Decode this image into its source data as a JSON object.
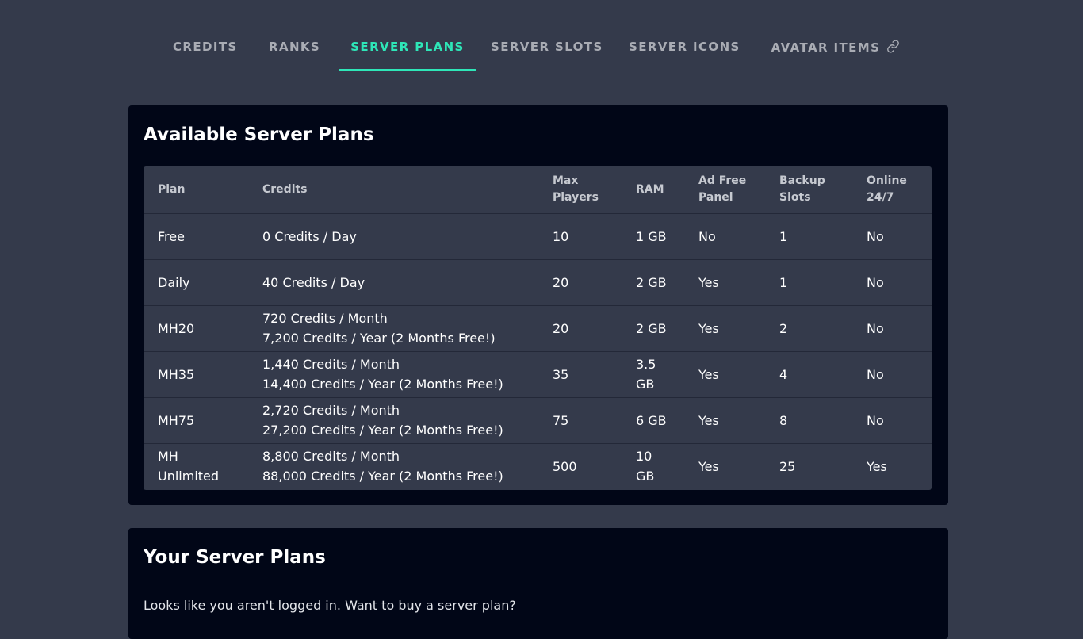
{
  "tabs": [
    {
      "label": "CREDITS",
      "active": false
    },
    {
      "label": "RANKS",
      "active": false
    },
    {
      "label": "SERVER PLANS",
      "active": true
    },
    {
      "label": "SERVER SLOTS",
      "active": false
    },
    {
      "label": "SERVER ICONS",
      "active": false
    },
    {
      "label": "AVATAR ITEMS",
      "active": false,
      "icon": "external-link-icon"
    }
  ],
  "colors": {
    "background": "#343a4b",
    "card": "#010617",
    "accent": "#2ee6b8",
    "tab_text": "#a9acb4"
  },
  "available_plans": {
    "title": "Available Server Plans",
    "headers": [
      [
        "Plan"
      ],
      [
        "Credits"
      ],
      [
        "Max",
        "Players"
      ],
      [
        "RAM"
      ],
      [
        "Ad Free",
        "Panel"
      ],
      [
        "Backup",
        "Slots"
      ],
      [
        "Online",
        "24/7"
      ]
    ],
    "rows": [
      {
        "plan": [
          "Free"
        ],
        "credits": [
          "0 Credits / Day"
        ],
        "max_players": [
          "10"
        ],
        "ram": [
          "1 GB"
        ],
        "ad_free": [
          "No"
        ],
        "backup_slots": [
          "1"
        ],
        "online": [
          "No"
        ]
      },
      {
        "plan": [
          "Daily"
        ],
        "credits": [
          "40 Credits / Day"
        ],
        "max_players": [
          "20"
        ],
        "ram": [
          "2 GB"
        ],
        "ad_free": [
          "Yes"
        ],
        "backup_slots": [
          "1"
        ],
        "online": [
          "No"
        ]
      },
      {
        "plan": [
          "MH20"
        ],
        "credits": [
          "720 Credits / Month",
          "7,200 Credits / Year (2 Months Free!)"
        ],
        "max_players": [
          "20"
        ],
        "ram": [
          "2 GB"
        ],
        "ad_free": [
          "Yes"
        ],
        "backup_slots": [
          "2"
        ],
        "online": [
          "No"
        ]
      },
      {
        "plan": [
          "MH35"
        ],
        "credits": [
          "1,440 Credits / Month",
          "14,400 Credits / Year (2 Months Free!)"
        ],
        "max_players": [
          "35"
        ],
        "ram": [
          "3.5",
          "GB"
        ],
        "ad_free": [
          "Yes"
        ],
        "backup_slots": [
          "4"
        ],
        "online": [
          "No"
        ]
      },
      {
        "plan": [
          "MH75"
        ],
        "credits": [
          "2,720 Credits / Month",
          "27,200 Credits / Year (2 Months Free!)"
        ],
        "max_players": [
          "75"
        ],
        "ram": [
          "6 GB"
        ],
        "ad_free": [
          "Yes"
        ],
        "backup_slots": [
          "8"
        ],
        "online": [
          "No"
        ]
      },
      {
        "plan": [
          "MH",
          "Unlimited"
        ],
        "credits": [
          "8,800 Credits / Month",
          "88,000 Credits / Year (2 Months Free!)"
        ],
        "max_players": [
          "500"
        ],
        "ram": [
          "10",
          "GB"
        ],
        "ad_free": [
          "Yes"
        ],
        "backup_slots": [
          "25"
        ],
        "online": [
          "Yes"
        ]
      }
    ]
  },
  "your_plans": {
    "title": "Your Server Plans",
    "message": "Looks like you aren't logged in. Want to buy a server plan?"
  }
}
